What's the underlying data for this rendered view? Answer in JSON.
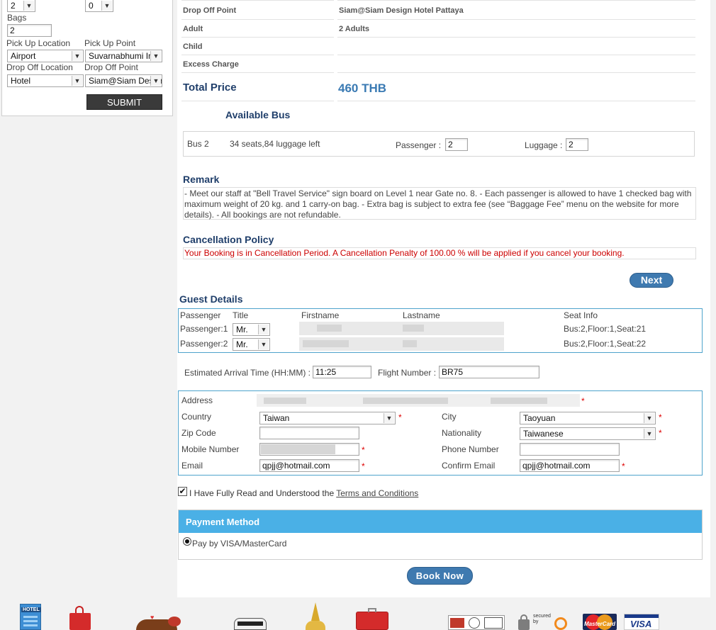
{
  "sidebar": {
    "passenger_select": "2",
    "child_select": "0",
    "bags_label": "Bags",
    "bags_value": "2",
    "pickup_location_label": "Pick Up Location",
    "pickup_location_value": "Airport",
    "pickup_point_label": "Pick Up Point",
    "pickup_point_value": "Suvarnabhumi Int",
    "dropoff_location_label": "Drop Off Location",
    "dropoff_location_value": "Hotel",
    "dropoff_point_label": "Drop Off Point",
    "dropoff_point_value": "Siam@Siam Design",
    "submit_label": "SUBMIT"
  },
  "summary": {
    "dropoff_label": "Drop Off Point",
    "dropoff_value": "Siam@Siam Design Hotel Pattaya",
    "adult_label": "Adult",
    "adult_value": "2 Adults",
    "child_label": "Child",
    "excess_label": "Excess Charge",
    "total_label": "Total Price",
    "total_value": "460 THB"
  },
  "bus": {
    "heading": "Available Bus",
    "name": "Bus 2",
    "info": "34 seats,84 luggage left",
    "passenger_label": "Passenger :",
    "passenger_value": "2",
    "luggage_label": "Luggage :",
    "luggage_value": "2"
  },
  "remark": {
    "heading": "Remark",
    "text": "- Meet our staff at \"Bell Travel Service\" sign board on Level 1 near Gate no. 8. - Each passenger is allowed to have 1 checked bag with maximum weight of 20 kg. and 1 carry-on bag. - Extra bag is subject to extra fee (see “Baggage Fee” menu on the website for more details). - All bookings are not refundable."
  },
  "cancellation": {
    "heading": "Cancellation Policy",
    "text": "Your Booking is in Cancellation Period. A Cancellation Penalty of 100.00 % will be applied if you cancel your booking."
  },
  "next_label": "Next",
  "guest": {
    "heading": "Guest Details",
    "col_passenger": "Passenger",
    "col_title": "Title",
    "col_firstname": "Firstname",
    "col_lastname": "Lastname",
    "col_seat": "Seat Info",
    "rows": [
      {
        "label": "Passenger:1",
        "title": "Mr.",
        "seat": "Bus:2,Floor:1,Seat:21"
      },
      {
        "label": "Passenger:2",
        "title": "Mr.",
        "seat": "Bus:2,Floor:1,Seat:22"
      }
    ]
  },
  "arrival": {
    "eta_label": "Estimated Arrival Time (HH:MM) :",
    "eta_value": "11:25",
    "flight_label": "Flight Number :",
    "flight_value": "BR75"
  },
  "contact": {
    "address_label": "Address",
    "country_label": "Country",
    "country_value": "Taiwan",
    "city_label": "City",
    "city_value": "Taoyuan",
    "zip_label": "Zip Code",
    "nationality_label": "Nationality",
    "nationality_value": "Taiwanese",
    "mobile_label": "Mobile Number",
    "phone_label": "Phone Number",
    "email_label": "Email",
    "email_value": "qpjj@hotmail.com",
    "confirm_label": "Confirm Email",
    "confirm_value": "qpjj@hotmail.com",
    "required_mark": "*"
  },
  "terms": {
    "prefix": "I Have Fully Read and Understood the",
    "link": "Terms and Conditions"
  },
  "payment": {
    "heading": "Payment Method",
    "option": "Pay by VISA/MasterCard"
  },
  "book_label": "Book Now",
  "footer": {
    "hotel_sign": "HOTEL",
    "mastercard": "MasterCard",
    "visa": "VISA",
    "secured": "secured by"
  },
  "colors": {
    "heading": "#1f3e6a",
    "price": "#3a7ab3",
    "payment_bar": "#4ab0e6",
    "pill": "#3f7ab0",
    "warning": "#cc0000"
  }
}
